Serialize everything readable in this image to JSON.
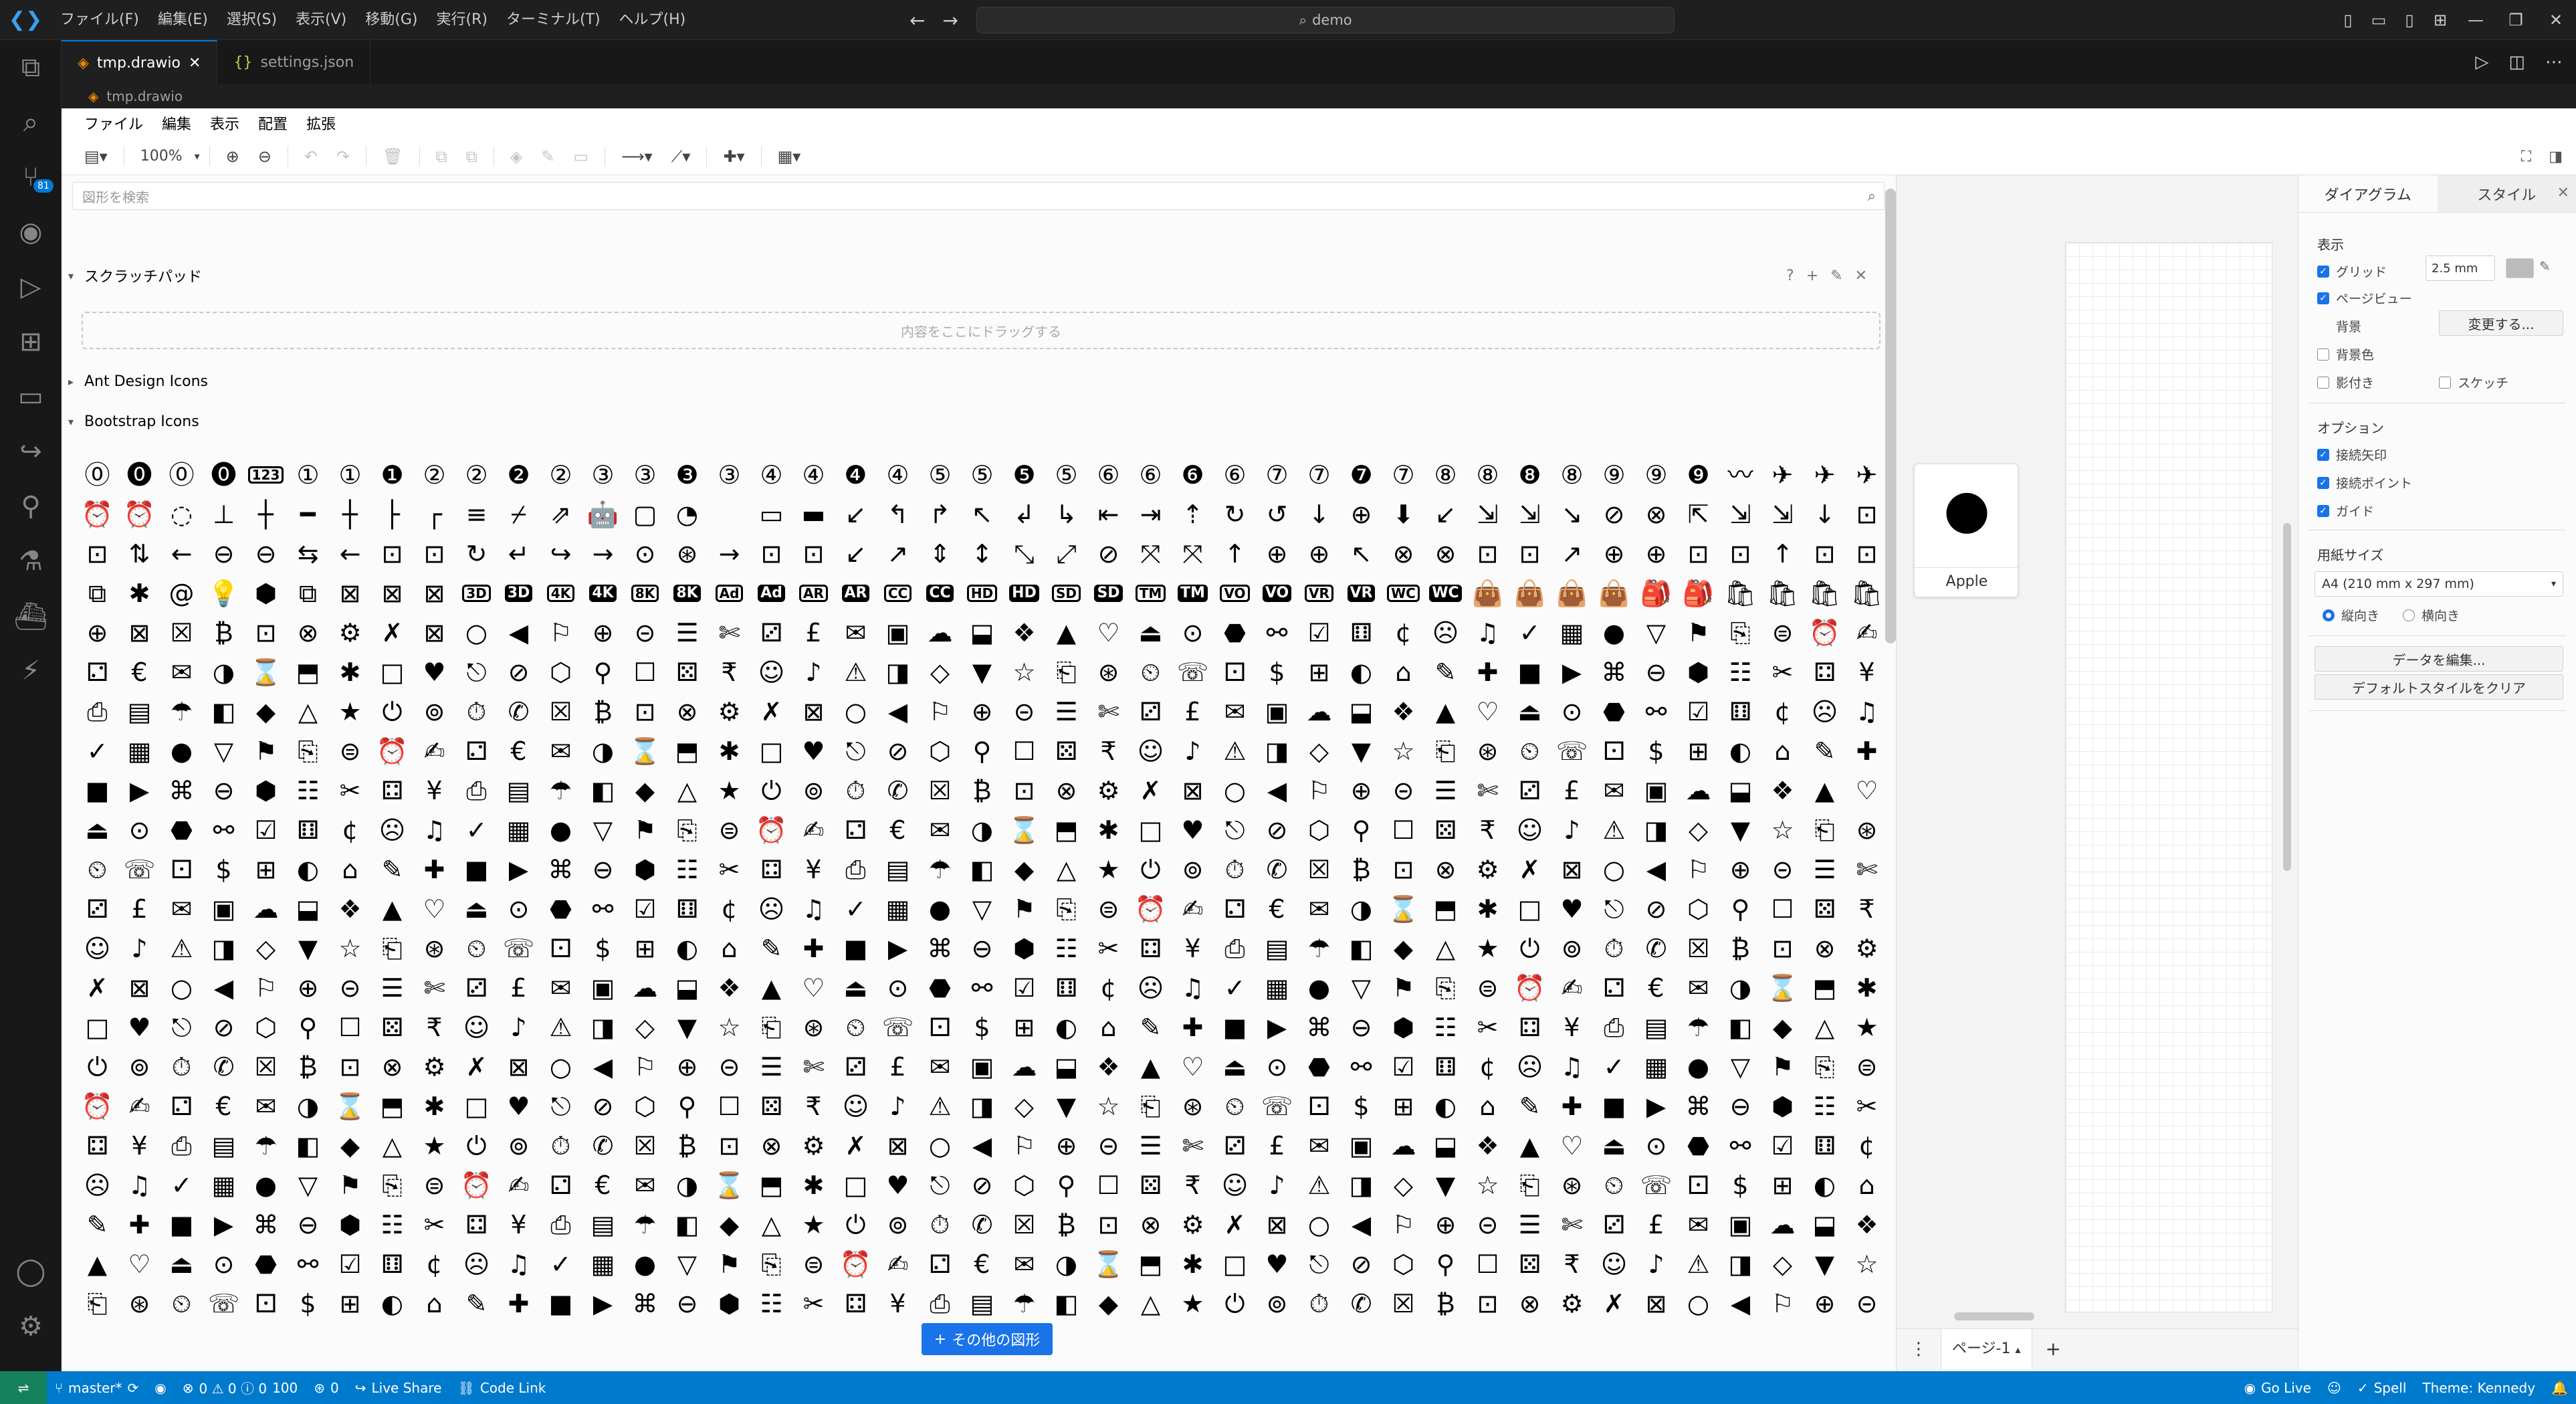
{
  "menubar": {
    "items": [
      "ファイル(F)",
      "編集(E)",
      "選択(S)",
      "表示(V)",
      "移動(G)",
      "実行(R)",
      "ターミナル(T)",
      "ヘルプ(H)"
    ],
    "search_text": "demo"
  },
  "tabs": [
    {
      "label": "tmp.drawio",
      "active": true
    },
    {
      "label": "settings.json",
      "active": false
    }
  ],
  "breadcrumb": "tmp.drawio",
  "activity_badge": "81",
  "drawio": {
    "menu": [
      "ファイル",
      "編集",
      "表示",
      "配置",
      "拡張"
    ],
    "zoom": "100%",
    "search_placeholder": "図形を検索",
    "scratchpad": {
      "title": "スクラッチパッド",
      "drop_hint": "内容をここにドラッグする"
    },
    "ant_design": "Ant Design Icons",
    "bootstrap": "Bootstrap Icons",
    "more_shapes": "その他の図形",
    "selected_shape_label": "Apple",
    "page_tab": "ページ-1",
    "format": {
      "tab_diagram": "ダイアグラム",
      "tab_style": "スタイル",
      "view_title": "表示",
      "grid": "グリッド",
      "grid_size": "2.5 mm",
      "page_view": "ページビュー",
      "background": "背景",
      "change": "変更する...",
      "background_color": "背景色",
      "shadow": "影付き",
      "sketch": "スケッチ",
      "options_title": "オプション",
      "connection_arrows": "接続矢印",
      "connection_points": "接続ポイント",
      "guides": "ガイド",
      "paper_title": "用紙サイズ",
      "paper_size": "A4 (210 mm x 297 mm)",
      "portrait": "縦向き",
      "landscape": "横向き",
      "edit_data": "データを編集...",
      "clear_default": "デフォルトスタイルをクリア"
    }
  },
  "statusbar": {
    "branch": "master*",
    "problems": "0 ⚠ 0 ⓘ 0",
    "info": "100",
    "ports": "0",
    "live_share": "Live Share",
    "code_link": "Code Link",
    "go_live": "Go Live",
    "spell": "Spell",
    "theme": "Theme: Kennedy"
  },
  "icon_seed": [
    "⓪",
    "⓿",
    "⓪",
    "⓿",
    "123",
    "①",
    "①",
    "❶",
    "②",
    "②",
    "❷",
    "②",
    "③",
    "③",
    "❸",
    "③",
    "④",
    "④",
    "❹",
    "④",
    "⑤",
    "⑤",
    "❺",
    "⑤",
    "⑥",
    "⑥",
    "❻",
    "⑥",
    "⑦",
    "⑦",
    "❼",
    "⑦",
    "⑧",
    "⑧",
    "❽",
    "⑧",
    "⑨",
    "⑨",
    "❾",
    "〰",
    "✈",
    "✈",
    "✈",
    "⏰",
    "⏰",
    "◌",
    "⊥",
    "┼",
    "━",
    "┼",
    "├",
    "┌",
    "≡",
    "⌿",
    "⇗",
    "🤖",
    "▢",
    "◔",
    "",
    "▭",
    "▬",
    "↙",
    "↰",
    "↱",
    "↖",
    "↲",
    "↳",
    "⇤",
    "⇥",
    "⇡",
    "↻",
    "↺",
    "↓",
    "⊕",
    "⬇",
    "↙",
    "⇲",
    "⇲",
    "↘",
    "⊘",
    "⊗",
    "⇱",
    "⇲",
    "⇲",
    "↓",
    "⊡",
    "⊡",
    "⇅",
    "←",
    "⊖",
    "⊖",
    "⇆",
    "←",
    "⊡",
    "⊡",
    "↻",
    "↵",
    "↪",
    "→",
    "⊙",
    "⊛",
    "→",
    "⊡",
    "⊡",
    "↙",
    "↗",
    "⇕",
    "↕",
    "⤡",
    "⤢",
    "⊘",
    "⤧",
    "⤧",
    "↑",
    "⊕",
    "⊕",
    "↖",
    "⊗",
    "⊗",
    "⊡",
    "⊡",
    "↗",
    "⊕",
    "⊕",
    "⊡",
    "⊡",
    "↑",
    "⊡",
    "⊡",
    "⧉",
    "✱",
    "@",
    "💡",
    "⬢",
    "⧉",
    "⊠",
    "⊠",
    "⊠",
    "3D",
    "3D",
    "4K",
    "4K",
    "8K",
    "8K",
    "Ad",
    "Ad",
    "AR",
    "AR",
    "CC",
    "CC",
    "HD",
    "HD",
    "SD",
    "SD",
    "TM",
    "TM",
    "VO",
    "VO",
    "VR",
    "VR",
    "WC",
    "WC",
    "👜",
    "👜",
    "👜",
    "👜",
    "🎒",
    "🎒",
    "🛍",
    "🛍",
    "🛍",
    "🛍",
    "⊕",
    "⊠"
  ]
}
